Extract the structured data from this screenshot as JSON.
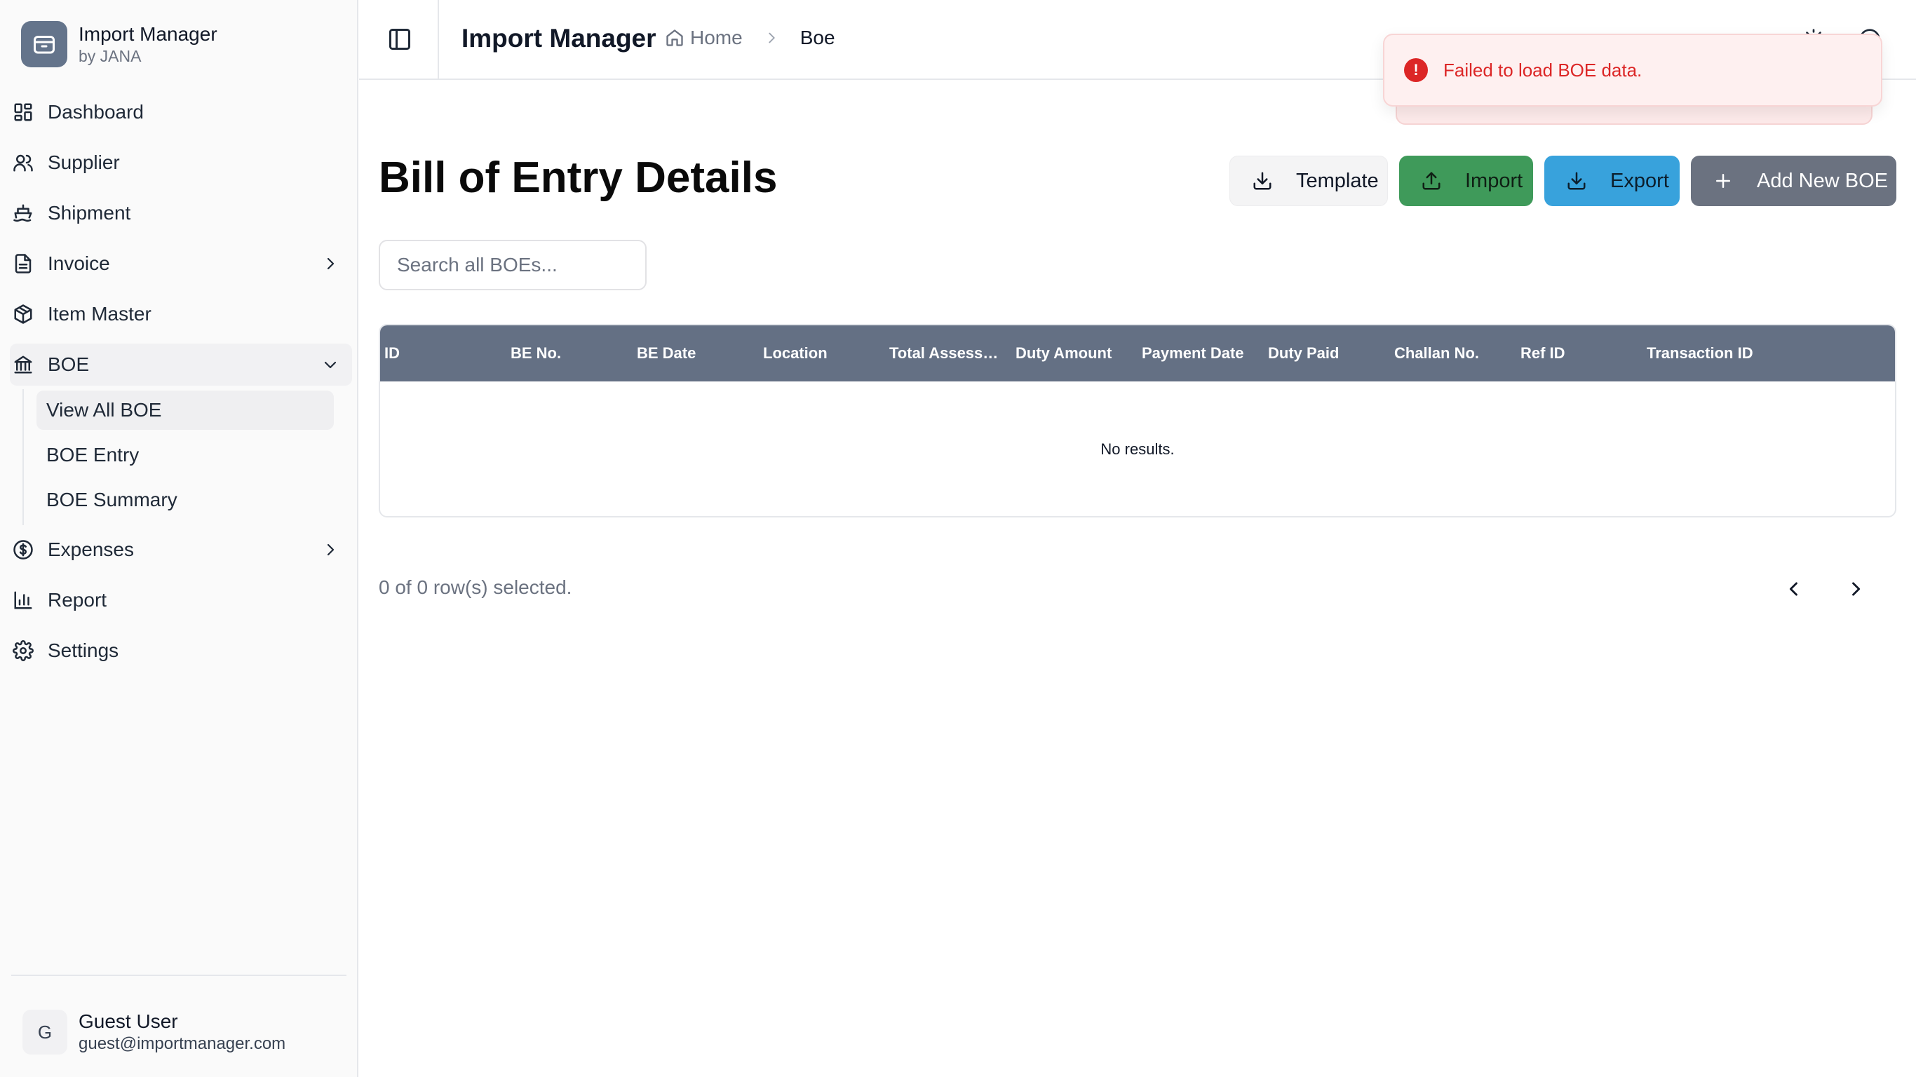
{
  "app": {
    "name": "Import Manager",
    "byline": "by JANA"
  },
  "sidebar": {
    "items": [
      {
        "label": "Dashboard",
        "icon": "dashboard-icon"
      },
      {
        "label": "Supplier",
        "icon": "users-icon"
      },
      {
        "label": "Shipment",
        "icon": "ship-icon"
      },
      {
        "label": "Invoice",
        "icon": "file-text-icon"
      },
      {
        "label": "Item Master",
        "icon": "package-icon"
      },
      {
        "label": "BOE",
        "icon": "landmark-icon"
      },
      {
        "label": "Expenses",
        "icon": "dollar-circle-icon"
      },
      {
        "label": "Report",
        "icon": "bar-chart-icon"
      },
      {
        "label": "Settings",
        "icon": "gear-icon"
      }
    ],
    "boe_sub": [
      "View All BOE",
      "BOE Entry",
      "BOE Summary"
    ]
  },
  "user": {
    "initial": "G",
    "name": "Guest User",
    "email": "guest@importmanager.com"
  },
  "header": {
    "title": "Import Manager",
    "breadcrumb_home": "Home",
    "breadcrumb_current": "Boe"
  },
  "toast": {
    "message": "Failed to load BOE data.",
    "color": "#dc2626"
  },
  "main": {
    "title": "Bill of Entry Details",
    "buttons": {
      "template": "Template",
      "import": "Import",
      "export": "Export",
      "add": "Add New BOE"
    },
    "search_placeholder": "Search all BOEs...",
    "columns": [
      "ID",
      "BE No.",
      "BE Date",
      "Location",
      "Total Assess…",
      "Duty Amount",
      "Payment Date",
      "Duty Paid",
      "Challan No.",
      "Ref ID",
      "Transaction ID"
    ],
    "empty_text": "No results.",
    "selection_text": "0 of 0 row(s) selected."
  },
  "colors": {
    "table_header": "#647084",
    "import": "#3f9a5a",
    "export": "#38a2dc",
    "add": "#6b7280"
  }
}
